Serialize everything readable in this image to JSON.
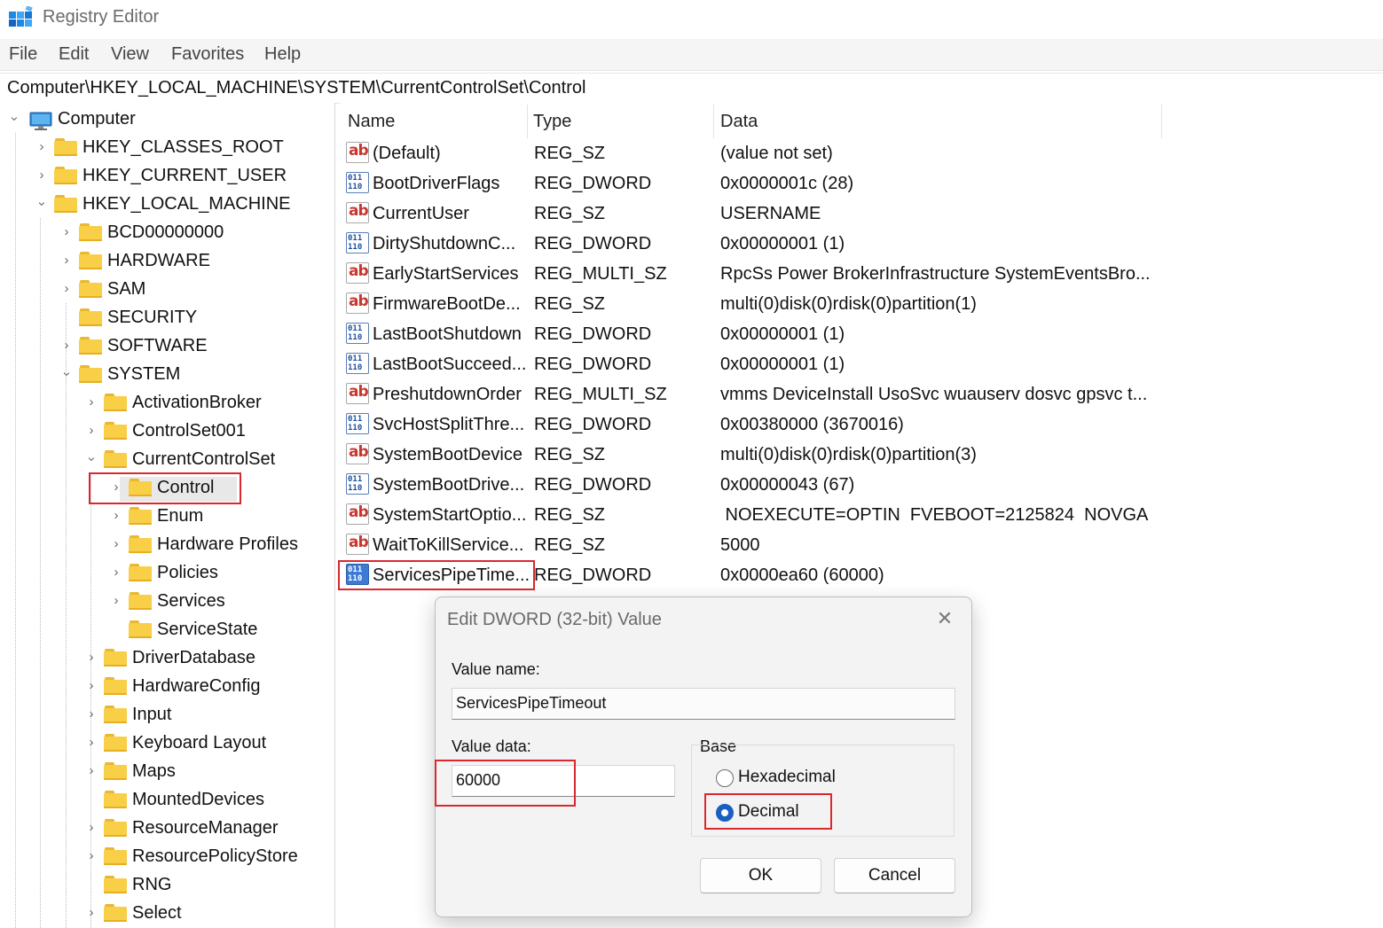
{
  "window": {
    "title": "Registry Editor"
  },
  "menu": [
    "File",
    "Edit",
    "View",
    "Favorites",
    "Help"
  ],
  "address": "Computer\\HKEY_LOCAL_MACHINE\\SYSTEM\\CurrentControlSet\\Control",
  "tree": {
    "root": "Computer",
    "items": [
      "HKEY_CLASSES_ROOT",
      "HKEY_CURRENT_USER",
      "HKEY_LOCAL_MACHINE",
      "BCD00000000",
      "HARDWARE",
      "SAM",
      "SECURITY",
      "SOFTWARE",
      "SYSTEM",
      "ActivationBroker",
      "ControlSet001",
      "CurrentControlSet",
      "Control",
      "Enum",
      "Hardware Profiles",
      "Policies",
      "Services",
      "ServiceState",
      "DriverDatabase",
      "HardwareConfig",
      "Input",
      "Keyboard Layout",
      "Maps",
      "MountedDevices",
      "ResourceManager",
      "ResourcePolicyStore",
      "RNG",
      "Select"
    ],
    "selected": "Control"
  },
  "values_table": {
    "headers": {
      "name": "Name",
      "type": "Type",
      "data": "Data"
    },
    "rows": [
      {
        "name": "(Default)",
        "type": "REG_SZ",
        "data": "(value not set)",
        "icon": "string-value-icon"
      },
      {
        "name": "BootDriverFlags",
        "type": "REG_DWORD",
        "data": "0x0000001c (28)",
        "icon": "binary-value-icon"
      },
      {
        "name": "CurrentUser",
        "type": "REG_SZ",
        "data": "USERNAME",
        "icon": "string-value-icon"
      },
      {
        "name": "DirtyShutdownC...",
        "type": "REG_DWORD",
        "data": "0x00000001 (1)",
        "icon": "binary-value-icon"
      },
      {
        "name": "EarlyStartServices",
        "type": "REG_MULTI_SZ",
        "data": "RpcSs Power BrokerInfrastructure SystemEventsBro...",
        "icon": "string-value-icon"
      },
      {
        "name": "FirmwareBootDe...",
        "type": "REG_SZ",
        "data": "multi(0)disk(0)rdisk(0)partition(1)",
        "icon": "string-value-icon"
      },
      {
        "name": "LastBootShutdown",
        "type": "REG_DWORD",
        "data": "0x00000001 (1)",
        "icon": "binary-value-icon"
      },
      {
        "name": "LastBootSucceed...",
        "type": "REG_DWORD",
        "data": "0x00000001 (1)",
        "icon": "binary-value-icon"
      },
      {
        "name": "PreshutdownOrder",
        "type": "REG_MULTI_SZ",
        "data": "vmms DeviceInstall UsoSvc wuauserv dosvc gpsvc t...",
        "icon": "string-value-icon"
      },
      {
        "name": "SvcHostSplitThre...",
        "type": "REG_DWORD",
        "data": "0x00380000 (3670016)",
        "icon": "binary-value-icon"
      },
      {
        "name": "SystemBootDevice",
        "type": "REG_SZ",
        "data": "multi(0)disk(0)rdisk(0)partition(3)",
        "icon": "string-value-icon"
      },
      {
        "name": "SystemBootDrive...",
        "type": "REG_DWORD",
        "data": "0x00000043 (67)",
        "icon": "binary-value-icon"
      },
      {
        "name": "SystemStartOptio...",
        "type": "REG_SZ",
        "data": " NOEXECUTE=OPTIN  FVEBOOT=2125824  NOVGA",
        "icon": "string-value-icon"
      },
      {
        "name": "WaitToKillService...",
        "type": "REG_SZ",
        "data": "5000",
        "icon": "string-value-icon"
      },
      {
        "name": "ServicesPipeTime...",
        "type": "REG_DWORD",
        "data": "0x0000ea60 (60000)",
        "icon": "binary-value-icon"
      }
    ],
    "selected": "ServicesPipeTime..."
  },
  "dialog": {
    "title": "Edit DWORD (32-bit) Value",
    "close_glyph": "✕",
    "value_name_label": "Value name:",
    "value_name": "ServicesPipeTimeout",
    "value_data_label": "Value data:",
    "value_data": "60000",
    "base_label": "Base",
    "base_options": [
      "Hexadecimal",
      "Decimal"
    ],
    "base_selected": "Decimal",
    "ok_label": "OK",
    "cancel_label": "Cancel"
  },
  "icons": {
    "ab_glyph": "ab",
    "bin_glyph": "011\n110",
    "chevron": "›"
  },
  "colors": {
    "highlight": "#d9282f",
    "radio_selected": "#1b5fc1",
    "folder": "#f8cf46"
  }
}
